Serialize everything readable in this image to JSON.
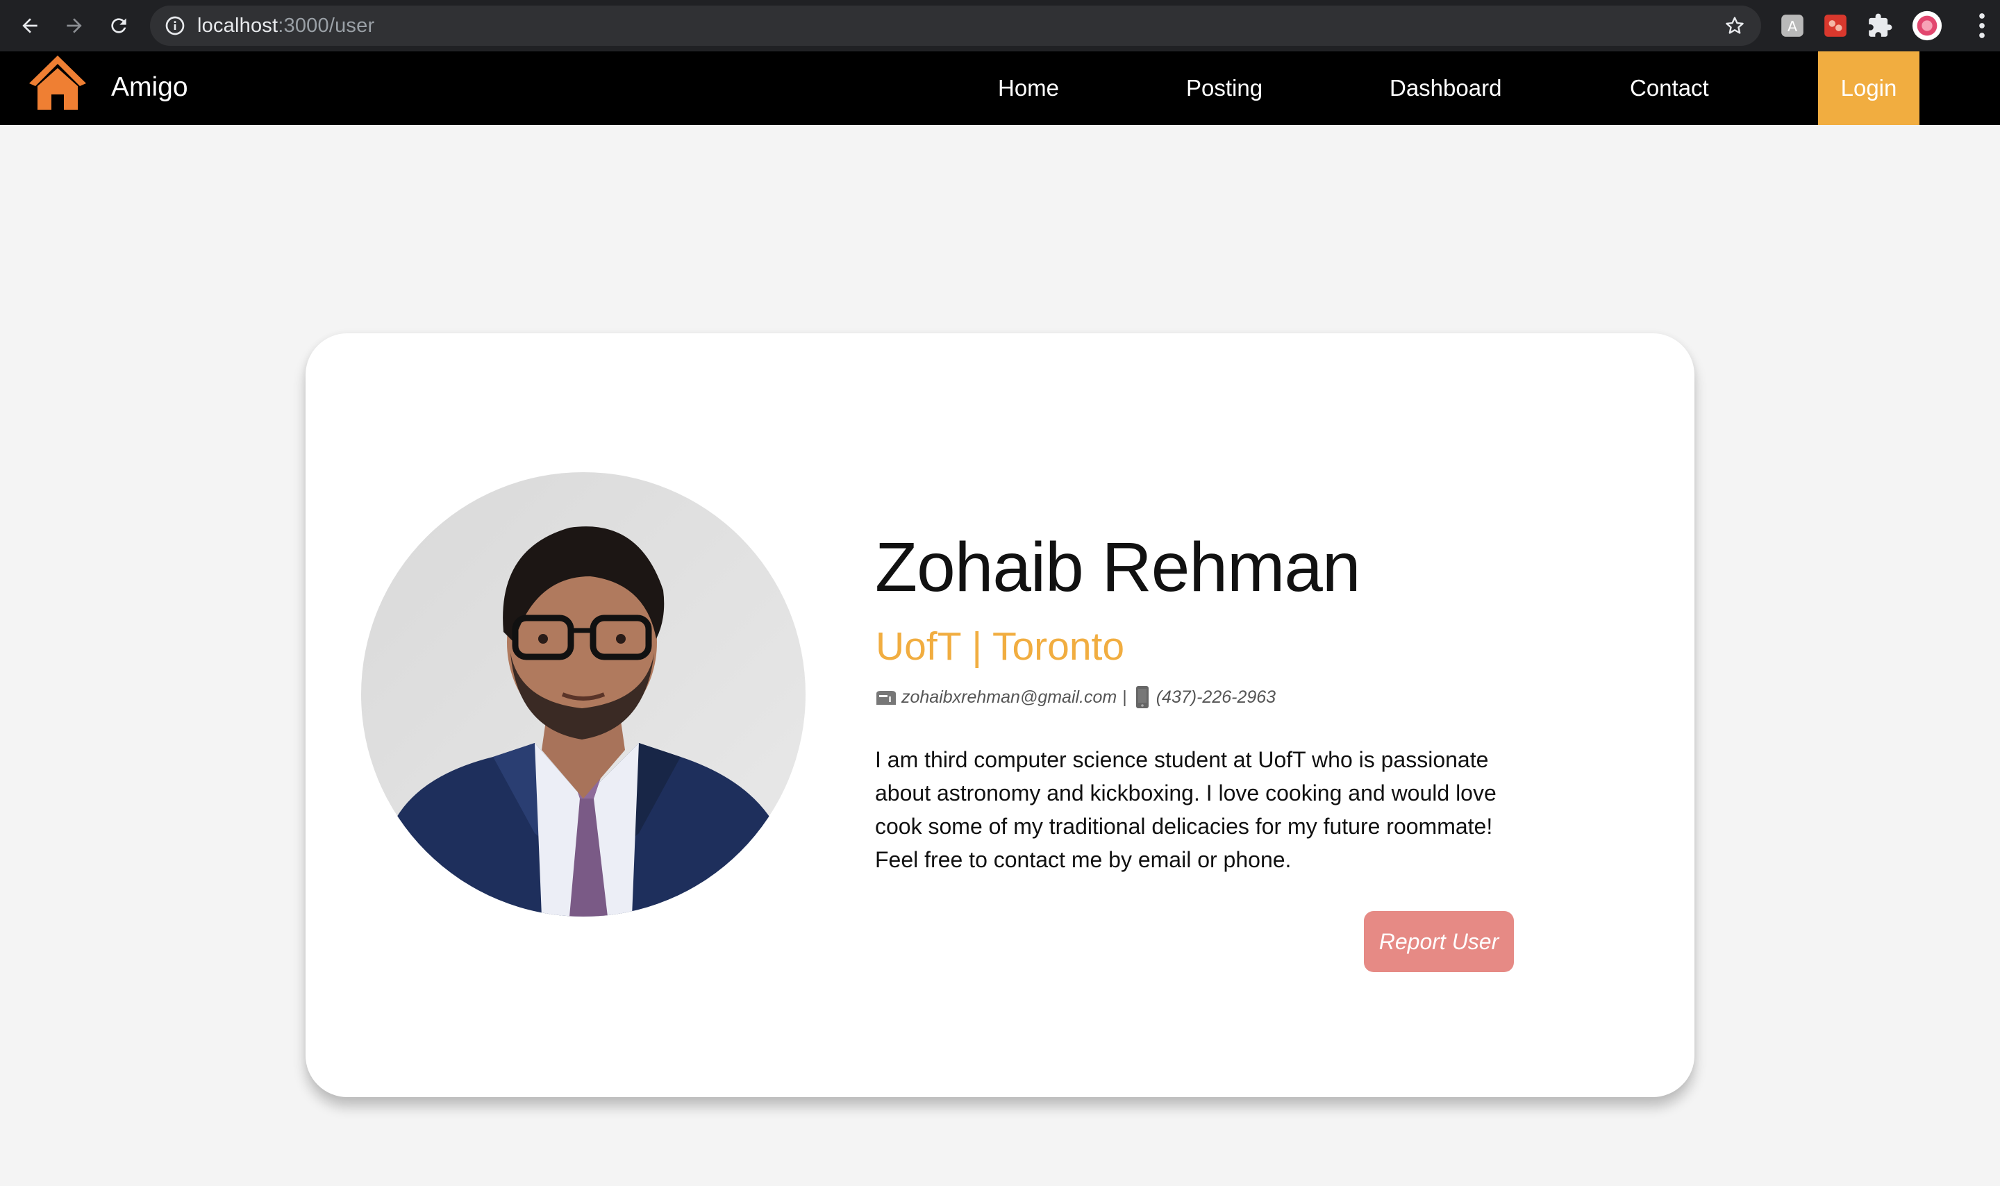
{
  "browser": {
    "url_host": "localhost",
    "url_path": ":3000/user"
  },
  "navbar": {
    "brand": "Amigo",
    "links": [
      "Home",
      "Posting",
      "Dashboard",
      "Contact"
    ],
    "login_label": "Login",
    "accent_color": "#f1ad40",
    "logo_icon": "house-icon"
  },
  "profile": {
    "name": "Zohaib Rehman",
    "subtitle": "UofT | Toronto",
    "email": "zohaibxrehman@gmail.com",
    "separator": "|",
    "phone": "(437)-226-2963",
    "email_icon": "mailbox-icon",
    "phone_icon": "mobile-phone-icon",
    "bio": "I am third computer science student at UofT who is passionate about astronomy and kickboxing. I love cooking and would love cook some of my traditional delicacies for my future roommate! Feel free to contact me by email or phone.",
    "report_label": "Report User",
    "report_color": "#e68a85"
  }
}
